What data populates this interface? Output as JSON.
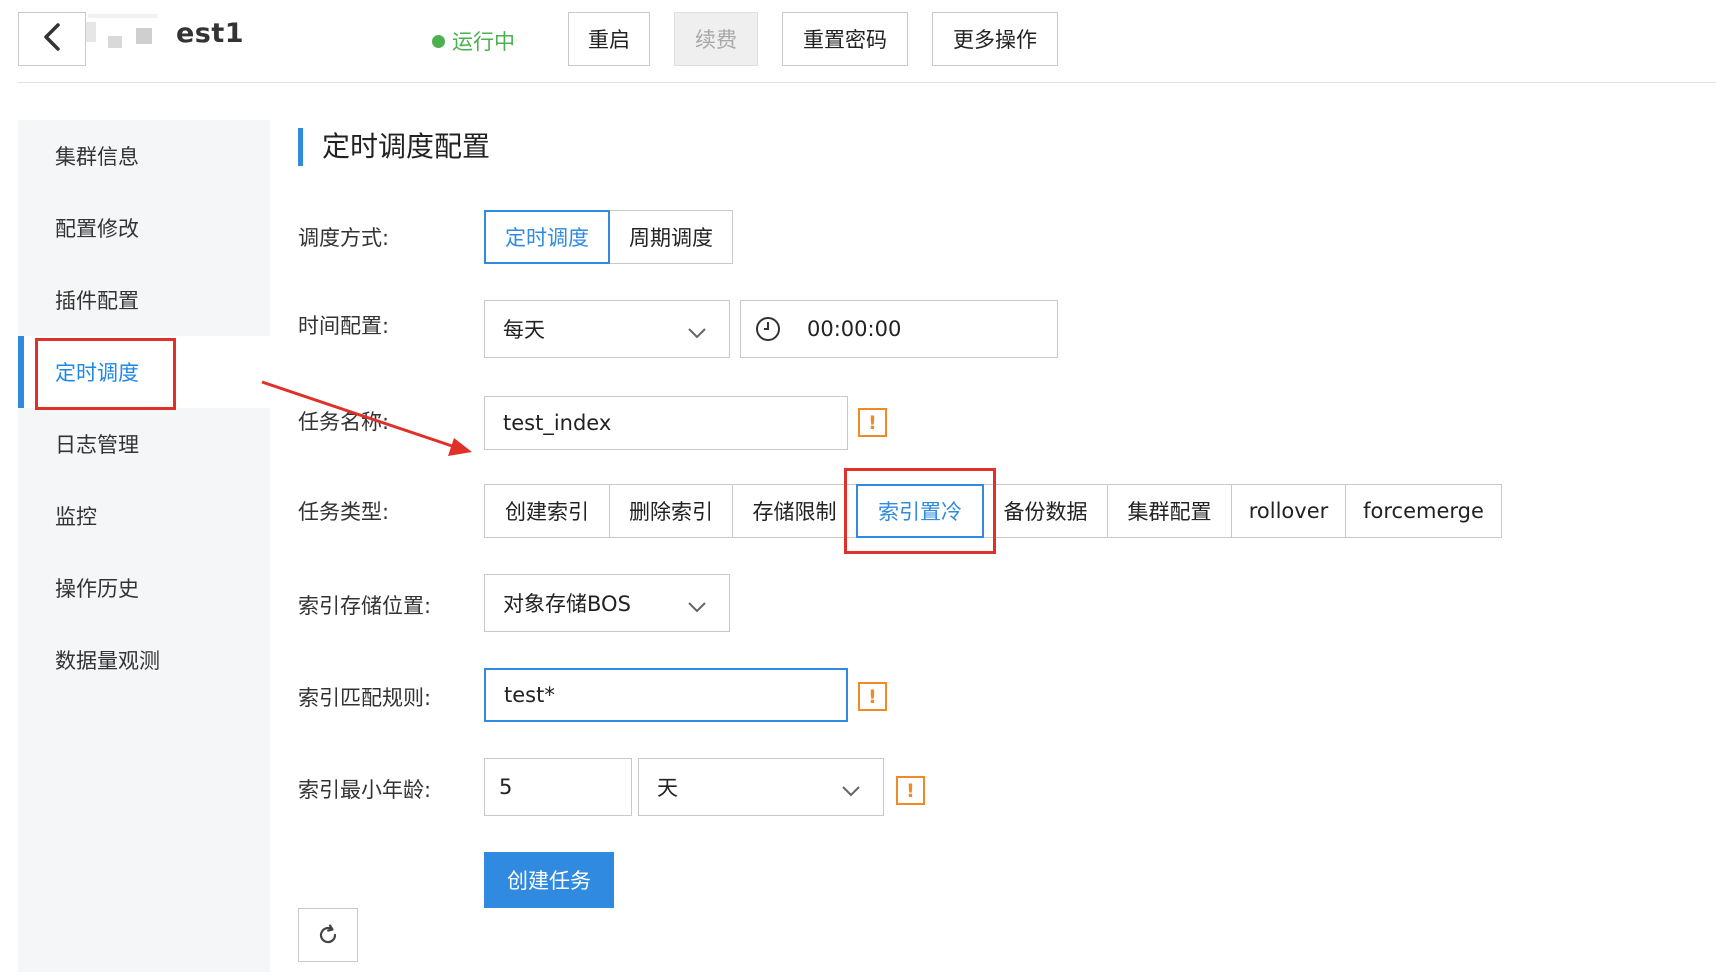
{
  "header": {
    "title": "est1",
    "status": "运行中",
    "buttons": [
      "重启",
      "续费",
      "重置密码",
      "更多操作"
    ]
  },
  "sidebar": {
    "items": [
      "集群信息",
      "配置修改",
      "插件配置",
      "定时调度",
      "日志管理",
      "监控",
      "操作历史",
      "数据量观测"
    ],
    "active": "定时调度"
  },
  "section": {
    "title": "定时调度配置"
  },
  "form": {
    "schedule_mode": {
      "label": "调度方式:",
      "options": [
        "定时调度",
        "周期调度"
      ],
      "selected": "定时调度"
    },
    "time_config": {
      "label": "时间配置:",
      "frequency": "每天",
      "time": "00:00:00"
    },
    "task_name": {
      "label": "任务名称:",
      "value": "test_index"
    },
    "task_type": {
      "label": "任务类型:",
      "options": [
        "创建索引",
        "删除索引",
        "存储限制",
        "索引置冷",
        "备份数据",
        "集群配置",
        "rollover",
        "forcemerge"
      ],
      "selected": "索引置冷"
    },
    "storage_location": {
      "label": "索引存储位置:",
      "value": "对象存储BOS"
    },
    "match_rule": {
      "label": "索引匹配规则:",
      "value": "test*"
    },
    "min_age": {
      "label": "索引最小年龄:",
      "value": "5",
      "unit": "天"
    },
    "warn_symbol": "!",
    "submit_label": "创建任务"
  },
  "colors": {
    "accent": "#2f8ae0",
    "status_green": "#4caf50",
    "warning_orange": "#f08a24",
    "annotation_red": "#e0302a"
  },
  "icons": [
    "chevron-left-icon",
    "clock-icon",
    "chevron-down-icon",
    "warning-icon",
    "refresh-icon"
  ]
}
